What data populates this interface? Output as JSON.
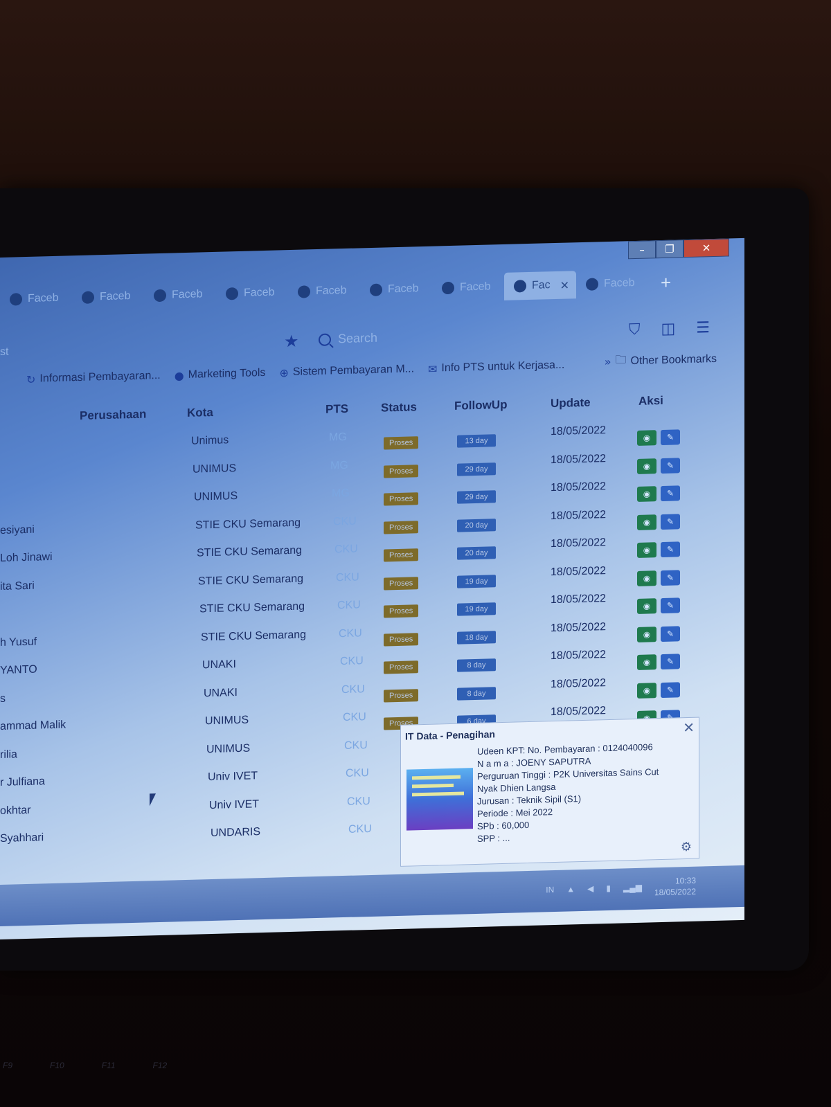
{
  "window": {
    "minimize": "–",
    "restore": "❐",
    "close": "✕"
  },
  "tabs": [
    {
      "label": "Faceb",
      "active": false
    },
    {
      "label": "Faceb",
      "active": false
    },
    {
      "label": "Faceb",
      "active": false
    },
    {
      "label": "Faceb",
      "active": false
    },
    {
      "label": "Faceb",
      "active": false
    },
    {
      "label": "Faceb",
      "active": false
    },
    {
      "label": "Faceb",
      "active": false
    },
    {
      "label": "Fac",
      "active": true
    },
    {
      "label": "Faceb",
      "active": false
    }
  ],
  "tab_close": "✕",
  "new_tab": "+",
  "toolbar": {
    "search_placeholder": "Search",
    "address_stub": "st"
  },
  "bookmarks": [
    {
      "label": "Informasi Pembayaran...",
      "icon": "refresh-icon"
    },
    {
      "label": "Marketing Tools",
      "icon": "facebook-icon"
    },
    {
      "label": "Sistem Pembayaran M...",
      "icon": "globe-icon"
    },
    {
      "label": "Info PTS untuk Kerjasa...",
      "icon": "doc-icon"
    }
  ],
  "bookmarks_more": "»",
  "other_bookmarks": "Other Bookmarks",
  "table": {
    "headers": {
      "perusahaan": "Perusahaan",
      "kota": "Kota",
      "pts": "PTS",
      "status": "Status",
      "followup": "FollowUp",
      "update": "Update",
      "aksi": "Aksi"
    },
    "rows": [
      {
        "name": "",
        "kota": "Unimus",
        "pts": "MG",
        "status": "Proses",
        "followup": "13 day",
        "update": "18/05/2022"
      },
      {
        "name": "",
        "kota": "UNIMUS",
        "pts": "MG",
        "status": "Proses",
        "followup": "29 day",
        "update": "18/05/2022"
      },
      {
        "name": "",
        "kota": "UNIMUS",
        "pts": "MG",
        "status": "Proses",
        "followup": "29 day",
        "update": "18/05/2022"
      },
      {
        "name": "esiyani",
        "kota": "STIE CKU Semarang",
        "pts": "CKU",
        "status": "Proses",
        "followup": "20 day",
        "update": "18/05/2022"
      },
      {
        "name": "Loh Jinawi",
        "kota": "STIE CKU Semarang",
        "pts": "CKU",
        "status": "Proses",
        "followup": "20 day",
        "update": "18/05/2022"
      },
      {
        "name": "ita Sari",
        "kota": "STIE CKU Semarang",
        "pts": "CKU",
        "status": "Proses",
        "followup": "19 day",
        "update": "18/05/2022"
      },
      {
        "name": "",
        "kota": "STIE CKU Semarang",
        "pts": "CKU",
        "status": "Proses",
        "followup": "19 day",
        "update": "18/05/2022"
      },
      {
        "name": "h Yusuf",
        "kota": "STIE CKU Semarang",
        "pts": "CKU",
        "status": "Proses",
        "followup": "18 day",
        "update": "18/05/2022"
      },
      {
        "name": "YANTO",
        "kota": "UNAKI",
        "pts": "CKU",
        "status": "Proses",
        "followup": "8 day",
        "update": "18/05/2022"
      },
      {
        "name": "s",
        "kota": "UNAKI",
        "pts": "CKU",
        "status": "Proses",
        "followup": "8 day",
        "update": "18/05/2022"
      },
      {
        "name": "ammad Malik",
        "kota": "UNIMUS",
        "pts": "CKU",
        "status": "Proses",
        "followup": "6 day",
        "update": "18/05/2022"
      },
      {
        "name": "rilia",
        "kota": "UNIMUS",
        "pts": "CKU",
        "status": "",
        "followup": "",
        "update": ""
      },
      {
        "name": "r Julfiana",
        "kota": "Univ IVET",
        "pts": "CKU",
        "status": "",
        "followup": "",
        "update": ""
      },
      {
        "name": "okhtar",
        "kota": "Univ IVET",
        "pts": "CKU",
        "status": "",
        "followup": "",
        "update": ""
      },
      {
        "name": "Syahhari",
        "kota": "UNDARIS",
        "pts": "CKU",
        "status": "",
        "followup": "",
        "update": ""
      }
    ]
  },
  "popup": {
    "title": "IT Data - Penagihan",
    "close": "✕",
    "lines": [
      "Udeen KPT: No. Pembayaran    : 0124040096",
      "N a m a  :  JOENY SAPUTRA",
      "Perguruan Tinggi :  P2K Universitas Sains Cut",
      "Nyak Dhien Langsa",
      "Jurusan  :  Teknik Sipil (S1)",
      "Periode  :  Mei 2022",
      "SPb :  60,000",
      "SPP :  ..."
    ]
  },
  "taskbar": {
    "lang": "IN",
    "time": "10:33",
    "date": "18/05/2022"
  },
  "fkeys": [
    "F9",
    "F10",
    "F11",
    "F12"
  ],
  "colors": {
    "proses": "#7d6b2a",
    "followup": "#2f5fb4",
    "view_button": "#1f7a4e",
    "edit_button": "#2f63c4"
  }
}
